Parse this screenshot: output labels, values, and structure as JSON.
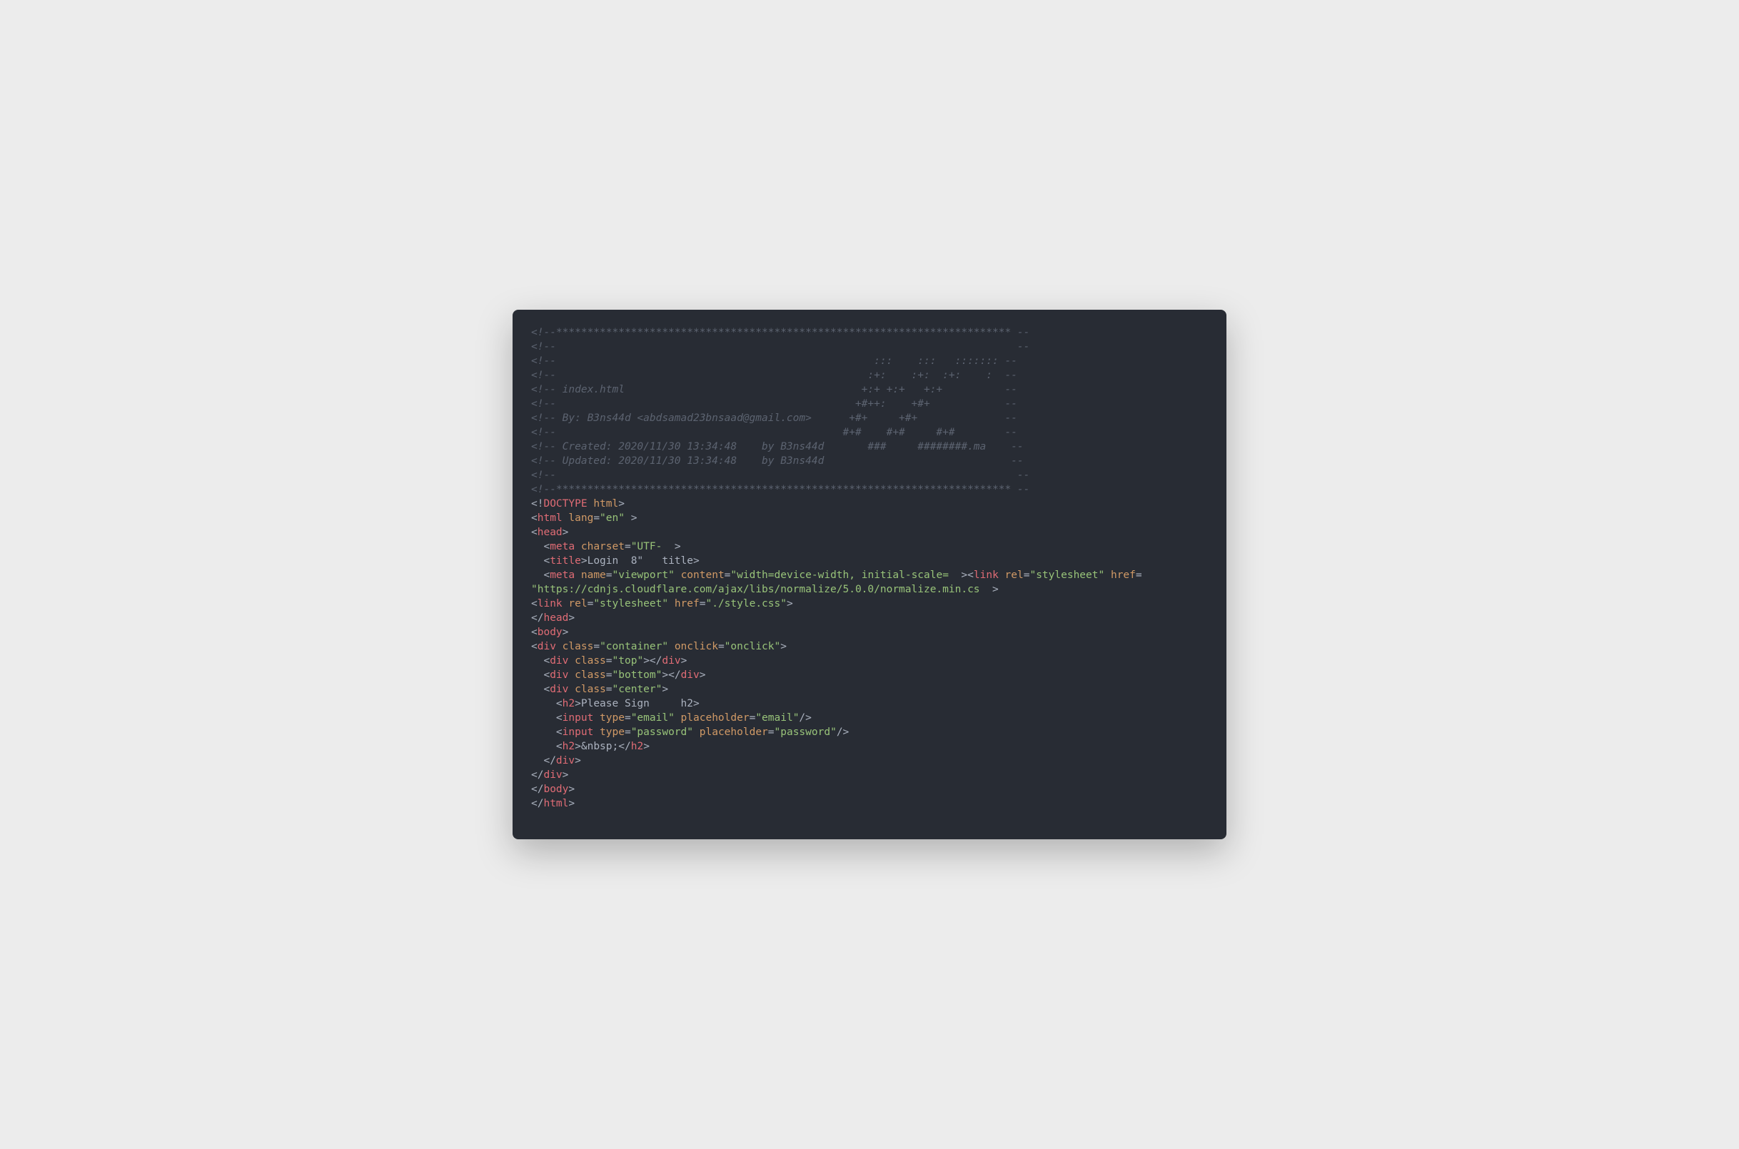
{
  "comments": {
    "l1": "<!--************************************************************************* --",
    "l2": "<!--                                                                          --",
    "l3": "<!--                                                   :::    :::   ::::::: --",
    "l4": "<!--                                                  :+:    :+:  :+:    :  --",
    "l5": "<!-- index.html                                      +:+ +:+   +:+          --",
    "l6": "<!--                                                +#++:    +#+            --",
    "l7": "<!-- By: B3ns44d <abdsamad23bnsaad@gmail.com>      +#+     +#+              --",
    "l8": "<!--                                              #+#    #+#     #+#        --",
    "l9": "<!-- Created: 2020/11/30 13:34:48    by B3ns44d       ###     ########.ma    --",
    "l10": "<!-- Updated: 2020/11/30 13:34:48    by B3ns44d                              --",
    "l11": "<!--                                                                          --",
    "l12": "<!--************************************************************************* --"
  },
  "doctype": {
    "open": "<!",
    "word": "DOCTYPE",
    "arg": "html",
    "close": ">"
  },
  "htmlTag": {
    "langAttr": "lang",
    "langVal": "\"en\""
  },
  "metaCharset": {
    "attr": "charset",
    "val": "\"UTF-",
    "trail": ">"
  },
  "title": {
    "text": "Login  8\"   title",
    "close": ">"
  },
  "metaViewport": {
    "attrName": "name",
    "valName": "\"viewport\"",
    "attrContent": "content",
    "valContent": "\"width=device-width, initial-scale=",
    "after": "><"
  },
  "linkNorm": {
    "relAttr": "rel",
    "relVal": "\"stylesheet\"",
    "hrefAttr": "href",
    "hrefVal": "\"https://cdnjs.cloudflare.com/ajax/libs/normalize/5.0.0/normalize.min.cs",
    "trail": ">"
  },
  "linkStyle": {
    "relAttr": "rel",
    "relVal": "\"stylesheet\"",
    "hrefAttr": "href",
    "hrefVal": "\"./style.css\""
  },
  "container": {
    "classAttr": "class",
    "classVal": "\"container\"",
    "onclickAttr": "onclick",
    "onclickVal": "\"onclick\""
  },
  "topDiv": {
    "classAttr": "class",
    "classVal": "\"top\""
  },
  "bottomDiv": {
    "classAttr": "class",
    "classVal": "\"bottom\""
  },
  "centerDiv": {
    "classAttr": "class",
    "classVal": "\"center\""
  },
  "h2text": "Please Sign     h2",
  "input1": {
    "tag": "input",
    "typeAttr": "type",
    "typeVal": "\"email\"",
    "phAttr": "placeholder",
    "phVal": "\"email\""
  },
  "input2": {
    "tag": "input",
    "typeAttr": "type",
    "typeVal": "\"password\"",
    "phAttr": "placeholder",
    "phVal": "\"password\""
  },
  "h2nbsp": "&nbsp;",
  "tags": {
    "html": "html",
    "head": "head",
    "meta": "meta",
    "title": "title",
    "link": "link",
    "body": "body",
    "div": "div",
    "h2": "h2",
    "input": "input"
  }
}
